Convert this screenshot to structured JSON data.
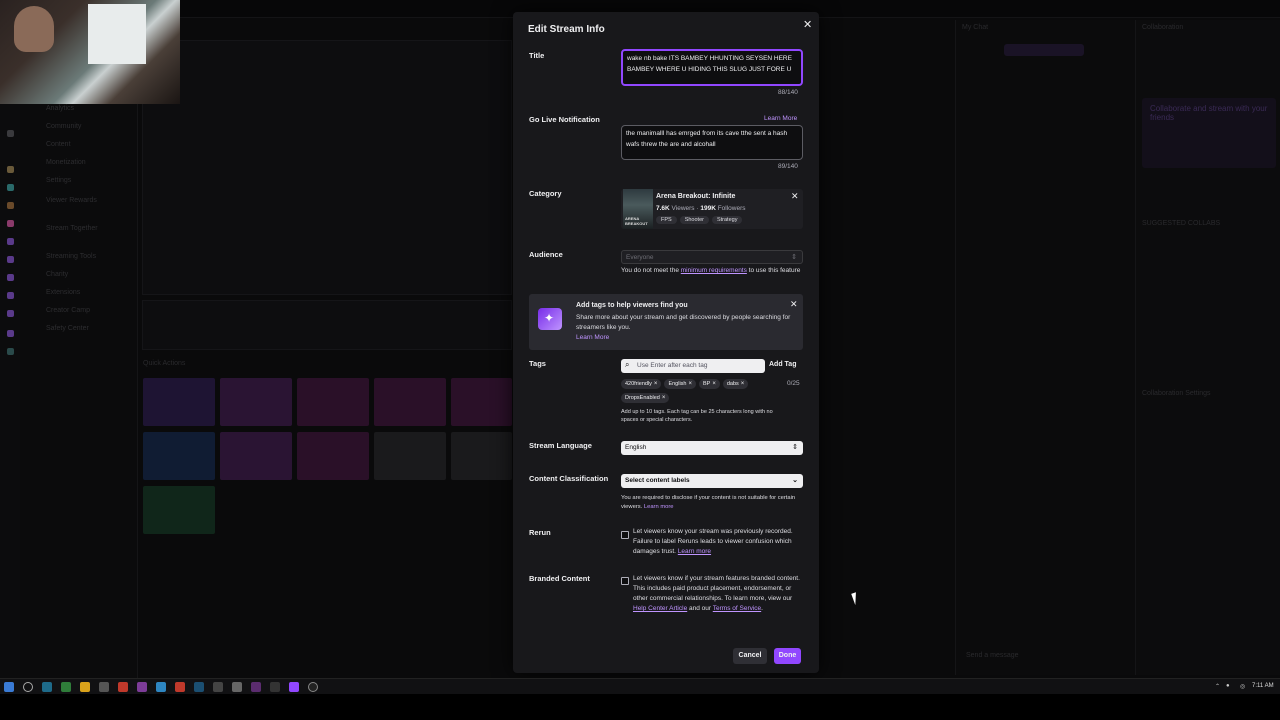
{
  "modal": {
    "title": "Edit Stream Info",
    "title_field": {
      "label": "Title",
      "value": "wake nb bake ITS BAMBEY HHUNTING SEYSEN HERE BAMBEY WHERE U HIDING THIS SLUG JUST FORE U",
      "count": "88/140"
    },
    "go_live": {
      "label": "Go Live Notification",
      "learn_more": "Learn More",
      "value": "the manimalll has emrged from its cave  tthe sent a hash wafs threw the are and alcohall",
      "count": "89/140"
    },
    "category": {
      "label": "Category",
      "name": "Arena Breakout: Infinite",
      "viewers": "7.6K",
      "viewers_label": "Viewers",
      "followers": "199K",
      "followers_label": "Followers",
      "tags": [
        "FPS",
        "Shooter",
        "Strategy"
      ],
      "art_text": "ARENA BREAKOUT"
    },
    "audience": {
      "label": "Audience",
      "value": "Everyone",
      "note_prefix": "You do not meet the",
      "note_link": "minimum requirements",
      "note_suffix": "to use this feature"
    },
    "promo": {
      "title": "Add tags to help viewers find you",
      "body": "Share more about your stream and get discovered by people searching for streamers like you.",
      "link": "Learn More"
    },
    "tags": {
      "label": "Tags",
      "placeholder": "Use Enter after each tag",
      "add_button": "Add Tag",
      "count": "0/25",
      "items": [
        "420friendly",
        "English",
        "BP",
        "dabs",
        "DropsEnabled"
      ],
      "help": "Add up to 10 tags. Each tag can be 25 characters long with no spaces or special characters."
    },
    "language": {
      "label": "Stream Language",
      "value": "English"
    },
    "classification": {
      "label": "Content Classification",
      "value": "Select content labels",
      "note": "You are required to disclose if your content is not suitable for certain viewers.",
      "link": "Learn more"
    },
    "rerun": {
      "label": "Rerun",
      "text": "Let viewers know your stream was previously recorded. Failure to label Reruns leads to viewer confusion which damages trust.",
      "link": "Learn more"
    },
    "branded": {
      "label": "Branded Content",
      "text": "Let viewers know if your stream features branded content. This includes paid product placement, endorsement, or other commercial relationships. To learn more, view our",
      "link1": "Help Center Article",
      "and": "and our",
      "link2": "Terms of Service",
      "end": "."
    },
    "cancel": "Cancel",
    "done": "Done"
  },
  "background": {
    "sidebar_items": [
      "Analytics",
      "Community",
      "Content",
      "Monetization",
      "Settings",
      "Viewer Rewards",
      "Stream Together",
      "Streaming Tools",
      "Charity",
      "Extensions",
      "Creator Camp",
      "Safety Center"
    ],
    "quick_actions": "Quick Actions",
    "chat_title": "My Chat",
    "collab_title": "Collaboration",
    "collab_heading": "Collaborate and stream with your friends",
    "suggested": "SUGGESTED COLLABS",
    "collab_settings": "Collaboration Settings",
    "chat_placeholder": "Send a message"
  },
  "taskbar": {
    "time": "7:11 AM"
  },
  "colors": {
    "accent": "#9147ff",
    "link": "#bf94ff",
    "modal_bg": "#18181b"
  }
}
